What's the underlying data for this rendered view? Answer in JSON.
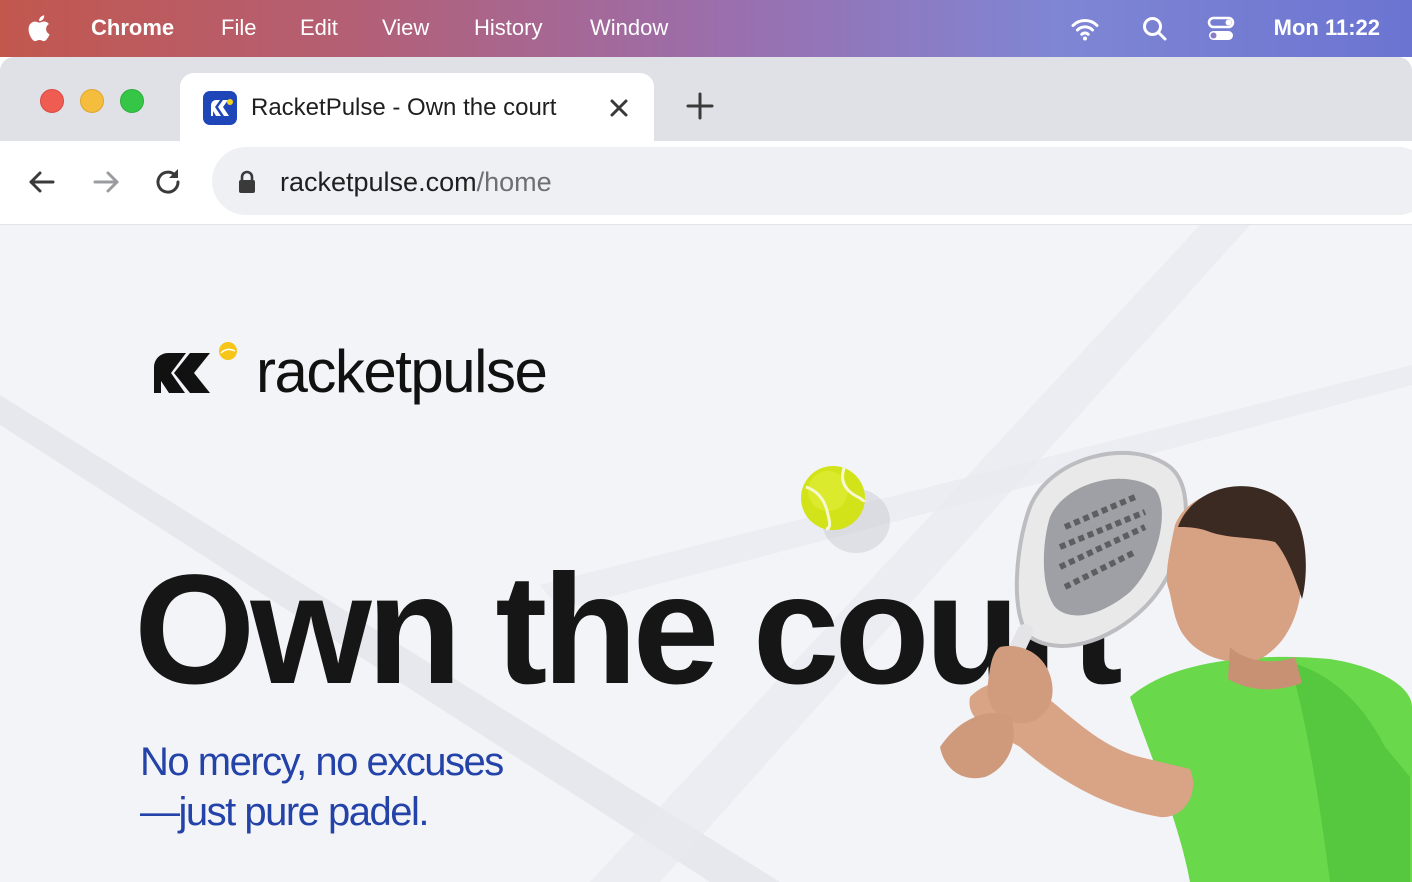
{
  "menubar": {
    "app_name": "Chrome",
    "items": [
      "File",
      "Edit",
      "View",
      "History",
      "Window"
    ],
    "clock": "Mon 11:22",
    "status_icons": [
      "wifi-icon",
      "spotlight-search-icon",
      "control-center-icon"
    ]
  },
  "browser": {
    "tab": {
      "title": "RacketPulse - Own the court",
      "favicon": "racketpulse-favicon"
    },
    "address": {
      "domain": "racketpulse.com",
      "path": "/home"
    }
  },
  "page": {
    "logo_text": "racketpulse",
    "hero_title": "Own the court",
    "hero_subtitle_line1": "No mercy, no excuses",
    "hero_subtitle_line2": "—just pure padel."
  },
  "colors": {
    "brand_blue": "#1f46b8",
    "subtitle_blue": "#2443a8",
    "ball_yellow": "#d8e81e",
    "page_bg": "#f3f4f8"
  }
}
